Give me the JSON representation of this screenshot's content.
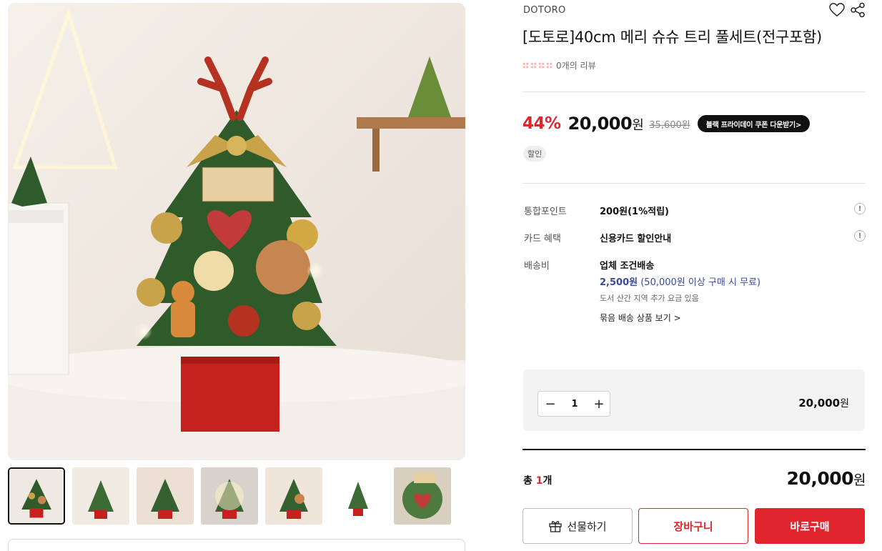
{
  "product": {
    "brand": "DOTORO",
    "title": "[도토로]40cm 메리 슈슈 트리 풀세트(전구포함)",
    "review_text": "0개의 리뷰",
    "images_alt": "Christmas tree product photo"
  },
  "price": {
    "discount": "44%",
    "sale_price": "20,000",
    "currency": "원",
    "original_price": "35,600원",
    "coupon_button": "블랙 프라이데이 쿠폰 다운받기>",
    "sale_badge": "할인"
  },
  "info": {
    "points_label": "통합포인트",
    "points_value": "200원(1%적립)",
    "card_label": "카드 혜택",
    "card_value": "신용카드 할인안내",
    "shipping_label": "배송비",
    "shipping_value": "업체 조건배송",
    "shipping_cost": "2,500원",
    "shipping_condition": " (50,000원 이상 구매 시 무료)",
    "shipping_note": "도서 산간 지역 추가 요금 있음",
    "bundle_link": "묶음 배송 상품 보기 >",
    "help_glyph": "!"
  },
  "quantity": {
    "value": "1",
    "minus": "−",
    "plus": "+",
    "line_price": "20,000",
    "currency": "원"
  },
  "total": {
    "label_prefix": "총 ",
    "count": "1",
    "label_suffix": "개",
    "price": "20,000",
    "currency": "원"
  },
  "actions": {
    "gift": "선물하기",
    "cart": "장바구니",
    "buy": "바로구매"
  },
  "colors": {
    "accent_red": "#e0262c",
    "shipping_blue": "#3b4a9c"
  },
  "icons": [
    "heart-icon",
    "share-icon",
    "gift-icon",
    "help-icon",
    "star-icon"
  ]
}
